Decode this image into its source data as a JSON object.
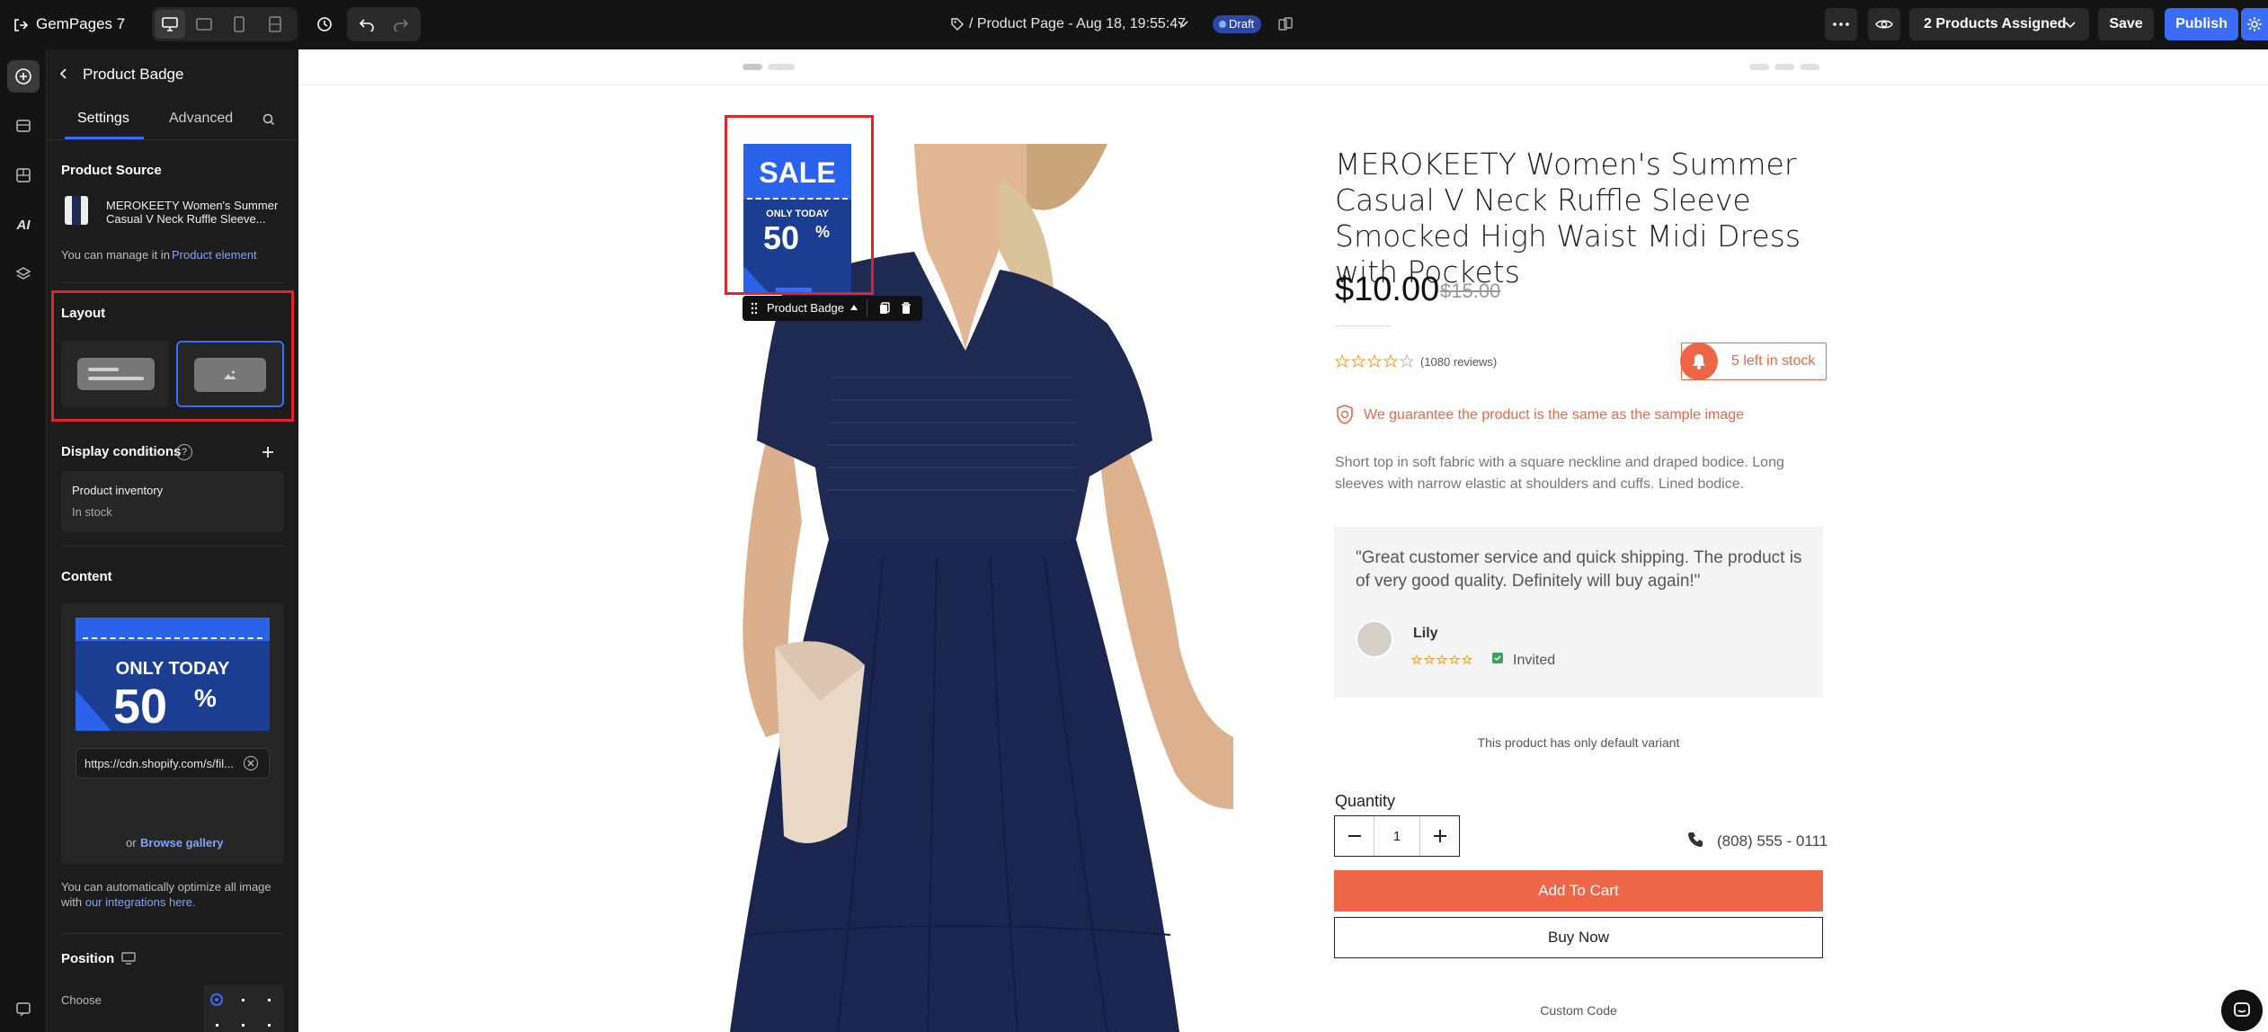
{
  "topbar": {
    "app_name": "GemPages 7",
    "page_title": "/ Product Page - Aug 18, 19:55:47",
    "status_badge": "Draft",
    "assigned_label": "2 Products Assigned",
    "save_label": "Save",
    "publish_label": "Publish"
  },
  "panel": {
    "title": "Product Badge",
    "tabs": [
      "Settings",
      "Advanced"
    ],
    "product_source": {
      "heading": "Product Source",
      "product_name": "MEROKEETY Women's Summer Casual V Neck Ruffle Sleeve...",
      "manage_text": "You can manage it in",
      "manage_link": "Product element"
    },
    "layout": {
      "heading": "Layout"
    },
    "display_conditions": {
      "heading": "Display conditions",
      "card_title": "Product inventory",
      "card_value": "In stock"
    },
    "content": {
      "heading": "Content",
      "image_url": "https://cdn.shopify.com/s/fil...",
      "or_text": "or",
      "browse_link": "Browse gallery",
      "optimize_text": "You can automatically optimize all image with",
      "optimize_link": "our integrations here."
    },
    "position": {
      "heading": "Position",
      "choose_label": "Choose"
    }
  },
  "badge": {
    "sale_text": "SALE",
    "only_today": "ONLY TODAY",
    "percent": "50",
    "percent_sign": "%",
    "toolbar_label": "Product Badge"
  },
  "product": {
    "title": "MEROKEETY Women's Summer Casual V Neck Ruffle Sleeve Smocked High Waist Midi Dress with Pockets",
    "price": "$10.00",
    "compare_price": "$15.00",
    "rating": 0,
    "reviews": "(1080 reviews)",
    "stock": "5 left in stock",
    "guarantee": "We guarantee the product is the same as the sample image",
    "description": "Short top in soft fabric with a square neckline and draped bodice. Long sleeves with narrow elastic at shoulders and cuffs. Lined bodice.",
    "testimonial": {
      "quote": "\"Great customer service and quick shipping. The product is of very good quality. Definitely will buy again!\"",
      "name": "Lily",
      "invited": "Invited"
    },
    "variant_note": "This product has only default variant",
    "quantity_label": "Quantity",
    "quantity_value": "1",
    "phone": "(808) 555 - 0111",
    "add_to_cart": "Add To Cart",
    "buy_now": "Buy Now",
    "custom_code": "Custom Code"
  },
  "colors": {
    "accent_blue": "#3b6cf6",
    "highlight_red": "#e0242b",
    "cart_orange": "#ec6647",
    "dress_navy": "#1e2a52"
  }
}
